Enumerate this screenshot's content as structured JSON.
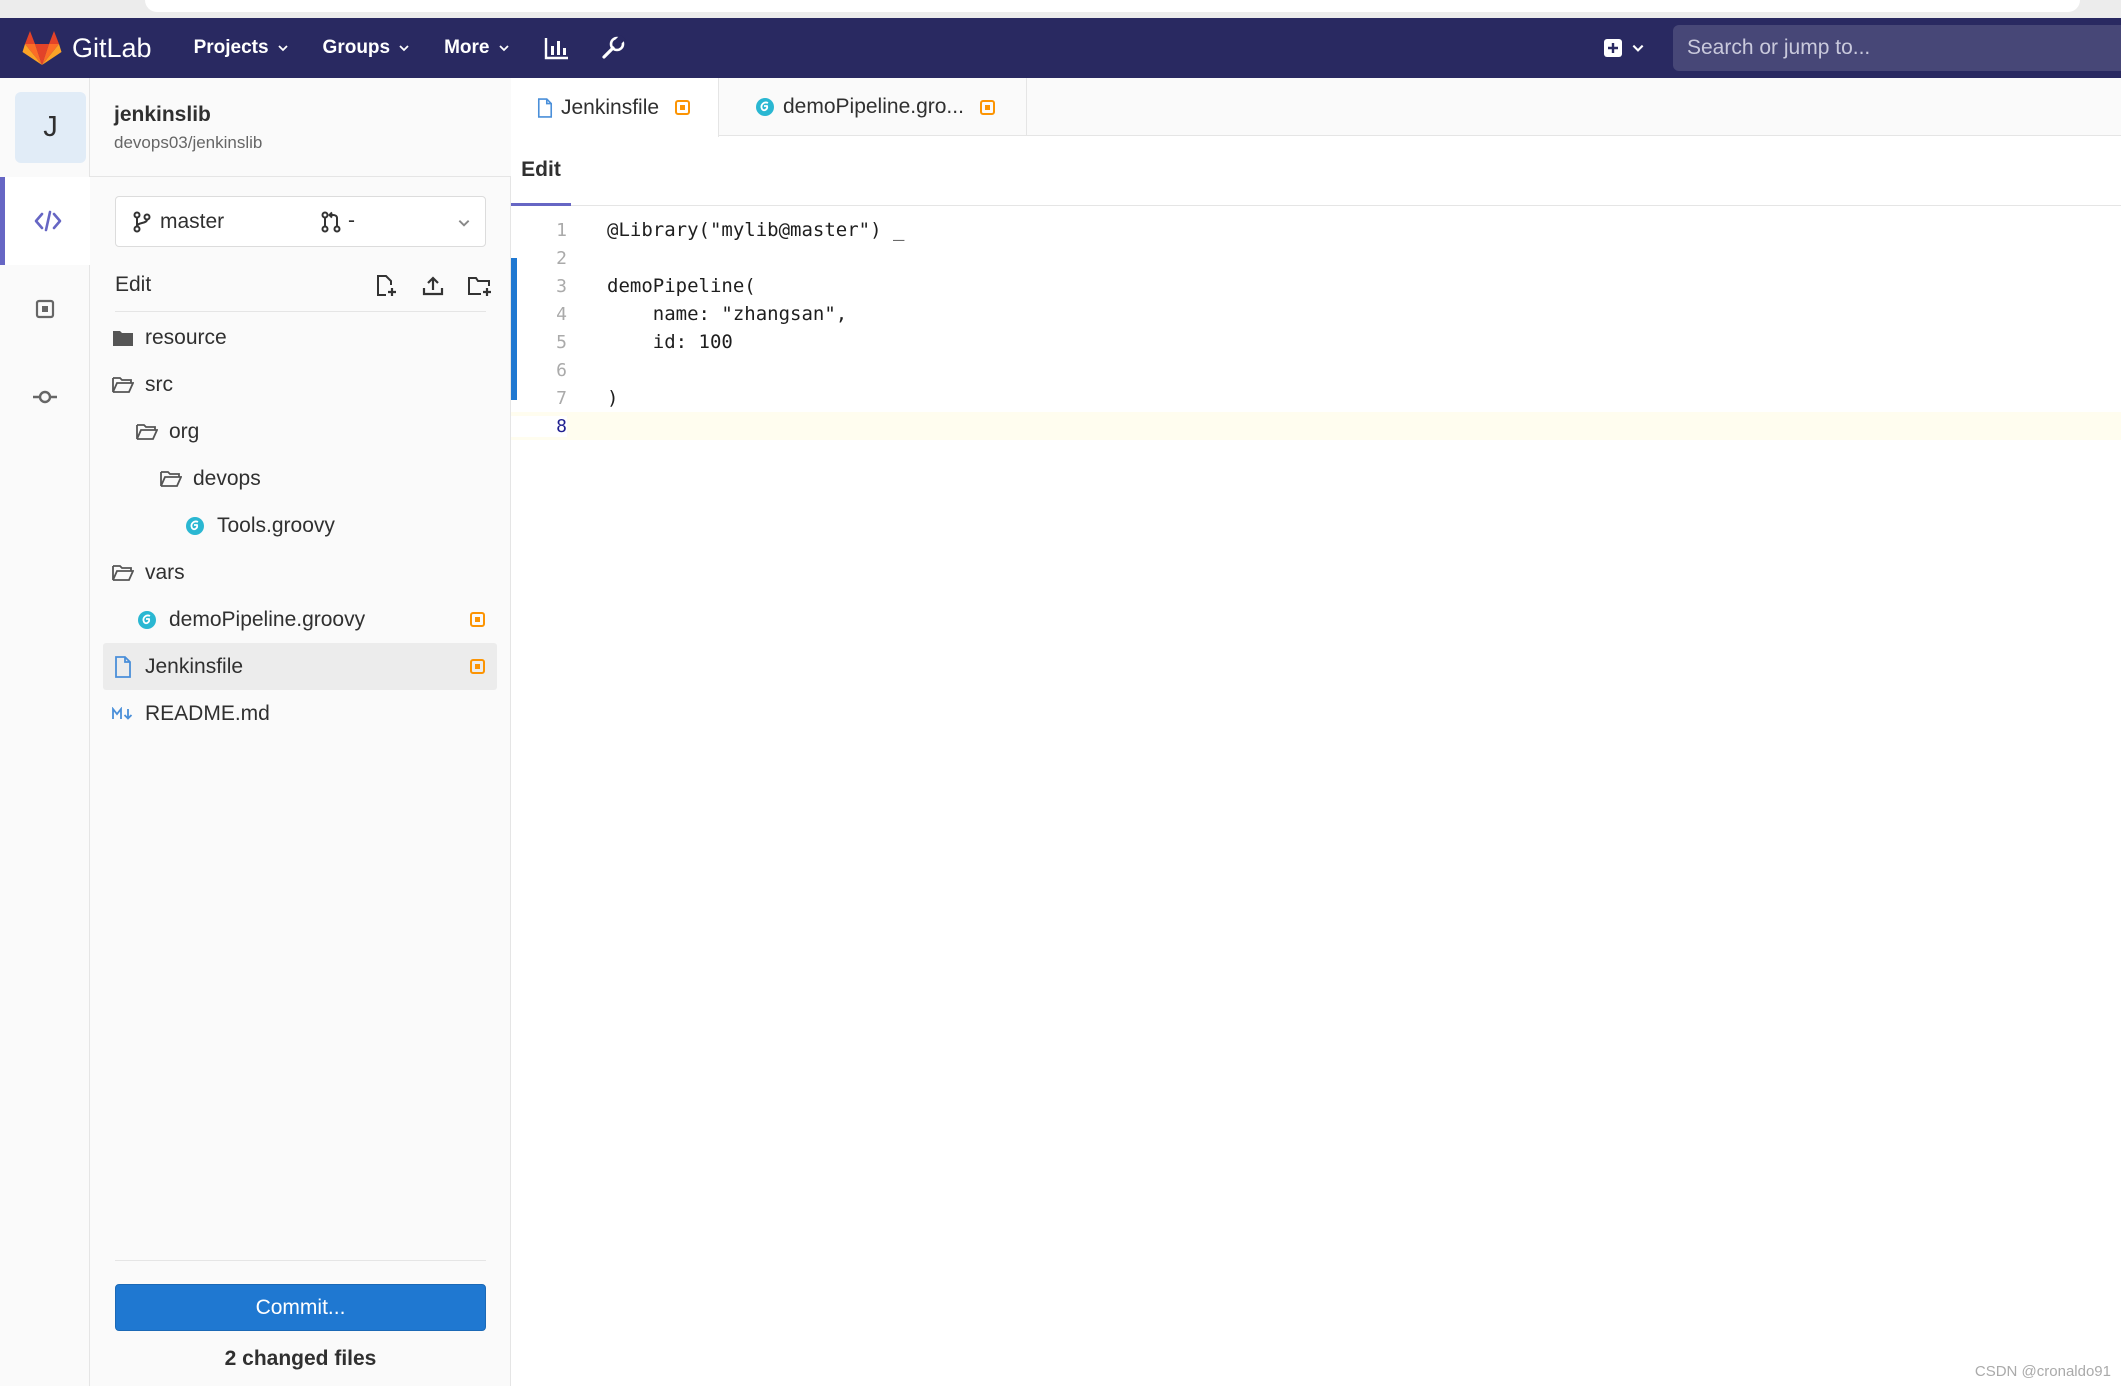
{
  "navbar": {
    "brand": "GitLab",
    "menus": [
      {
        "label": "Projects"
      },
      {
        "label": "Groups"
      },
      {
        "label": "More"
      }
    ],
    "search_placeholder": "Search or jump to..."
  },
  "project": {
    "avatar_letter": "J",
    "name": "jenkinslib",
    "path": "devops03/jenkinslib"
  },
  "branch": {
    "name": "master",
    "merge_request": "-"
  },
  "tree": {
    "toolbar_label": "Edit",
    "items": [
      {
        "name": "resource",
        "type": "folder"
      },
      {
        "name": "src",
        "type": "folder-open"
      },
      {
        "name": "org",
        "type": "folder-open"
      },
      {
        "name": "devops",
        "type": "folder-open"
      },
      {
        "name": "Tools.groovy",
        "type": "groovy"
      },
      {
        "name": "vars",
        "type": "folder-open"
      },
      {
        "name": "demoPipeline.groovy",
        "type": "groovy",
        "modified": true
      },
      {
        "name": "Jenkinsfile",
        "type": "file",
        "modified": true,
        "selected": true
      },
      {
        "name": "README.md",
        "type": "markdown"
      }
    ]
  },
  "commit": {
    "button_label": "Commit...",
    "changed_files": "2 changed files"
  },
  "editor": {
    "tabs": [
      {
        "label": "Jenkinsfile",
        "icon": "file-icon",
        "active": true
      },
      {
        "label": "demoPipeline.gro...",
        "icon": "groovy-icon",
        "active": false
      }
    ],
    "mode": "Edit",
    "lines": [
      {
        "n": "1",
        "text": "@Library(\"mylib@master\") _"
      },
      {
        "n": "2",
        "text": ""
      },
      {
        "n": "3",
        "text": "demoPipeline("
      },
      {
        "n": "4",
        "text": "    name: \"zhangsan\","
      },
      {
        "n": "5",
        "text": "    id: 100"
      },
      {
        "n": "6",
        "text": ""
      },
      {
        "n": "7",
        "text": ")"
      },
      {
        "n": "8",
        "text": ""
      }
    ]
  },
  "watermark": "CSDN @cronaldo91",
  "colors": {
    "navbar": "#292961",
    "accent": "#6666c4",
    "primary_button": "#1f78d1",
    "modified_badge": "#fc9403",
    "groovy_icon": "#2ab7d2"
  }
}
